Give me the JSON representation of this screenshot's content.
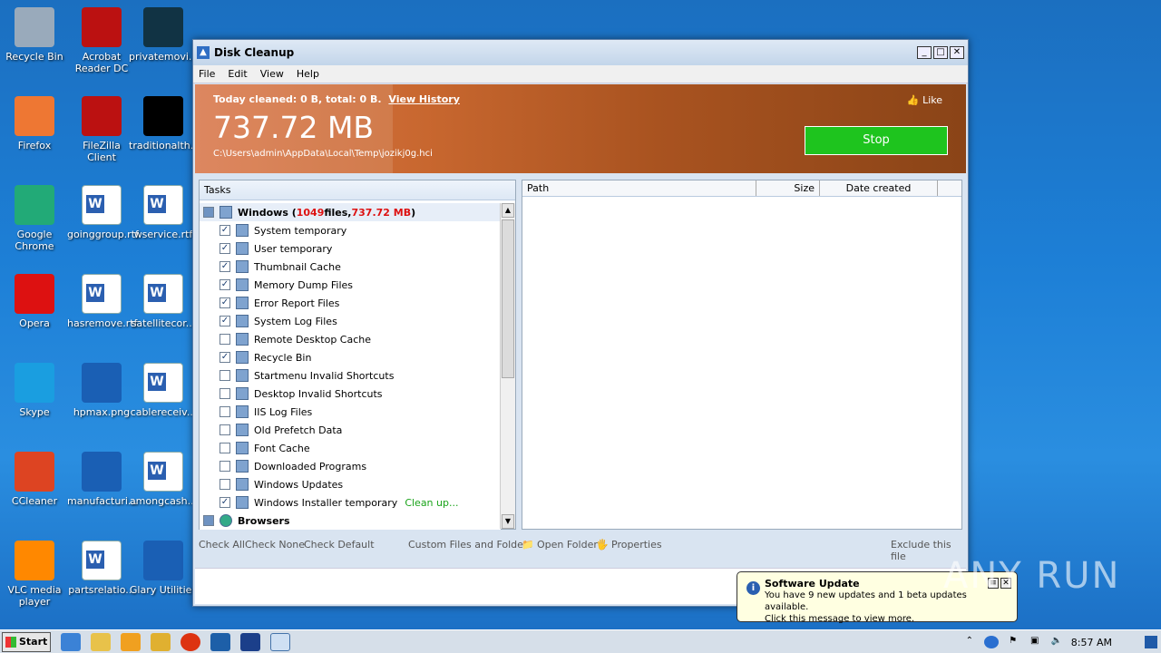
{
  "desktop": {
    "icons": [
      {
        "label": "Recycle Bin"
      },
      {
        "label": "Acrobat Reader DC"
      },
      {
        "label": "privatemovi..."
      },
      {
        "label": "Firefox"
      },
      {
        "label": "FileZilla Client"
      },
      {
        "label": "traditionalth..."
      },
      {
        "label": "Google Chrome"
      },
      {
        "label": "goinggroup.rtf"
      },
      {
        "label": "wservice.rtf"
      },
      {
        "label": "Opera"
      },
      {
        "label": "hasremove.rtf"
      },
      {
        "label": "satellitecor..."
      },
      {
        "label": "Skype"
      },
      {
        "label": "hpmax.png"
      },
      {
        "label": "cablereceiv..."
      },
      {
        "label": "CCleaner"
      },
      {
        "label": "manufacturi..."
      },
      {
        "label": "amongcash..."
      },
      {
        "label": "VLC media player"
      },
      {
        "label": "partsrelatio..."
      },
      {
        "label": "Glary Utilities"
      }
    ]
  },
  "window": {
    "title": "Disk Cleanup",
    "menu": [
      "File",
      "Edit",
      "View",
      "Help"
    ],
    "banner": {
      "today": "Today cleaned: 0 B, total: 0 B.",
      "view_history": "View History",
      "size": "737.72 MB",
      "path": "C:\\Users\\admin\\AppData\\Local\\Temp\\jozikj0g.hci",
      "like": "Like",
      "stop": "Stop"
    },
    "tasks": {
      "header": "Tasks",
      "group_windows": {
        "name": "Windows",
        "files": "1049",
        "files_label": " files, ",
        "size": "737.72 MB"
      },
      "items": [
        {
          "label": "System temporary",
          "checked": true
        },
        {
          "label": "User temporary",
          "checked": true
        },
        {
          "label": "Thumbnail Cache",
          "checked": true
        },
        {
          "label": "Memory Dump Files",
          "checked": true
        },
        {
          "label": "Error Report Files",
          "checked": true
        },
        {
          "label": "System Log Files",
          "checked": true
        },
        {
          "label": "Remote Desktop Cache",
          "checked": false
        },
        {
          "label": "Recycle Bin",
          "checked": true
        },
        {
          "label": "Startmenu Invalid Shortcuts",
          "checked": false
        },
        {
          "label": "Desktop Invalid Shortcuts",
          "checked": false
        },
        {
          "label": "IIS Log Files",
          "checked": false
        },
        {
          "label": "Old Prefetch Data",
          "checked": false
        },
        {
          "label": "Font Cache",
          "checked": false
        },
        {
          "label": "Downloaded Programs",
          "checked": false
        },
        {
          "label": "Windows Updates",
          "checked": false
        },
        {
          "label": "Windows Installer temporary",
          "checked": true,
          "status": "Clean up..."
        }
      ],
      "group_browsers": "Browsers"
    },
    "files": {
      "columns": [
        "Path",
        "Size",
        "Date created"
      ]
    },
    "actions": {
      "check_all": "Check All",
      "check_none": "Check None",
      "check_default": "Check Default",
      "custom": "Custom Files and Folders",
      "open_folder": "Open Folder",
      "properties": "Properties",
      "exclude": "Exclude this file"
    }
  },
  "balloon": {
    "title": "Software Update",
    "line1": "You have 9 new updates and 1 beta updates available.",
    "line2": "Click this message to view more."
  },
  "watermark": "ANY RUN",
  "taskbar": {
    "start": "Start",
    "clock": "8:57 AM"
  }
}
